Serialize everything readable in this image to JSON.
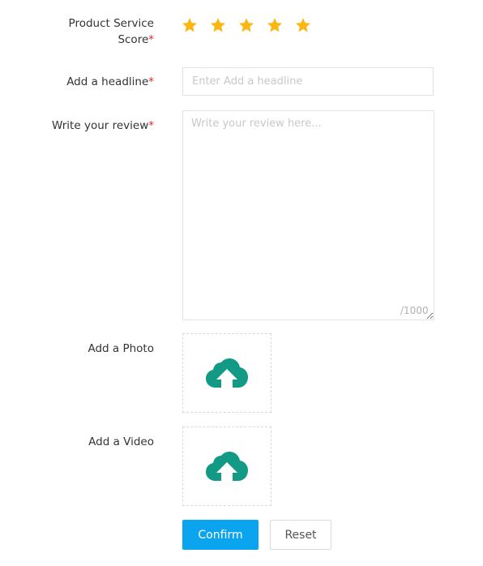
{
  "form": {
    "score": {
      "label_line1": "Product Service",
      "label_line2": "Score",
      "required_mark": "*",
      "rating": 5,
      "max_rating": 5,
      "star_color": "#fbb611"
    },
    "headline": {
      "label": "Add a headline",
      "required_mark": "*",
      "value": "",
      "placeholder": "Enter Add a headline"
    },
    "review": {
      "label": "Write your review",
      "required_mark": "*",
      "value": "",
      "placeholder": "Write your review here...",
      "counter": "/1000"
    },
    "photo": {
      "label": "Add a Photo",
      "icon": "cloud-upload-icon"
    },
    "video": {
      "label": "Add a Video",
      "icon": "cloud-upload-icon"
    },
    "buttons": {
      "confirm_label": "Confirm",
      "reset_label": "Reset",
      "confirm_color": "#0aa5ee"
    },
    "accent_icon_color": "#129a85"
  }
}
